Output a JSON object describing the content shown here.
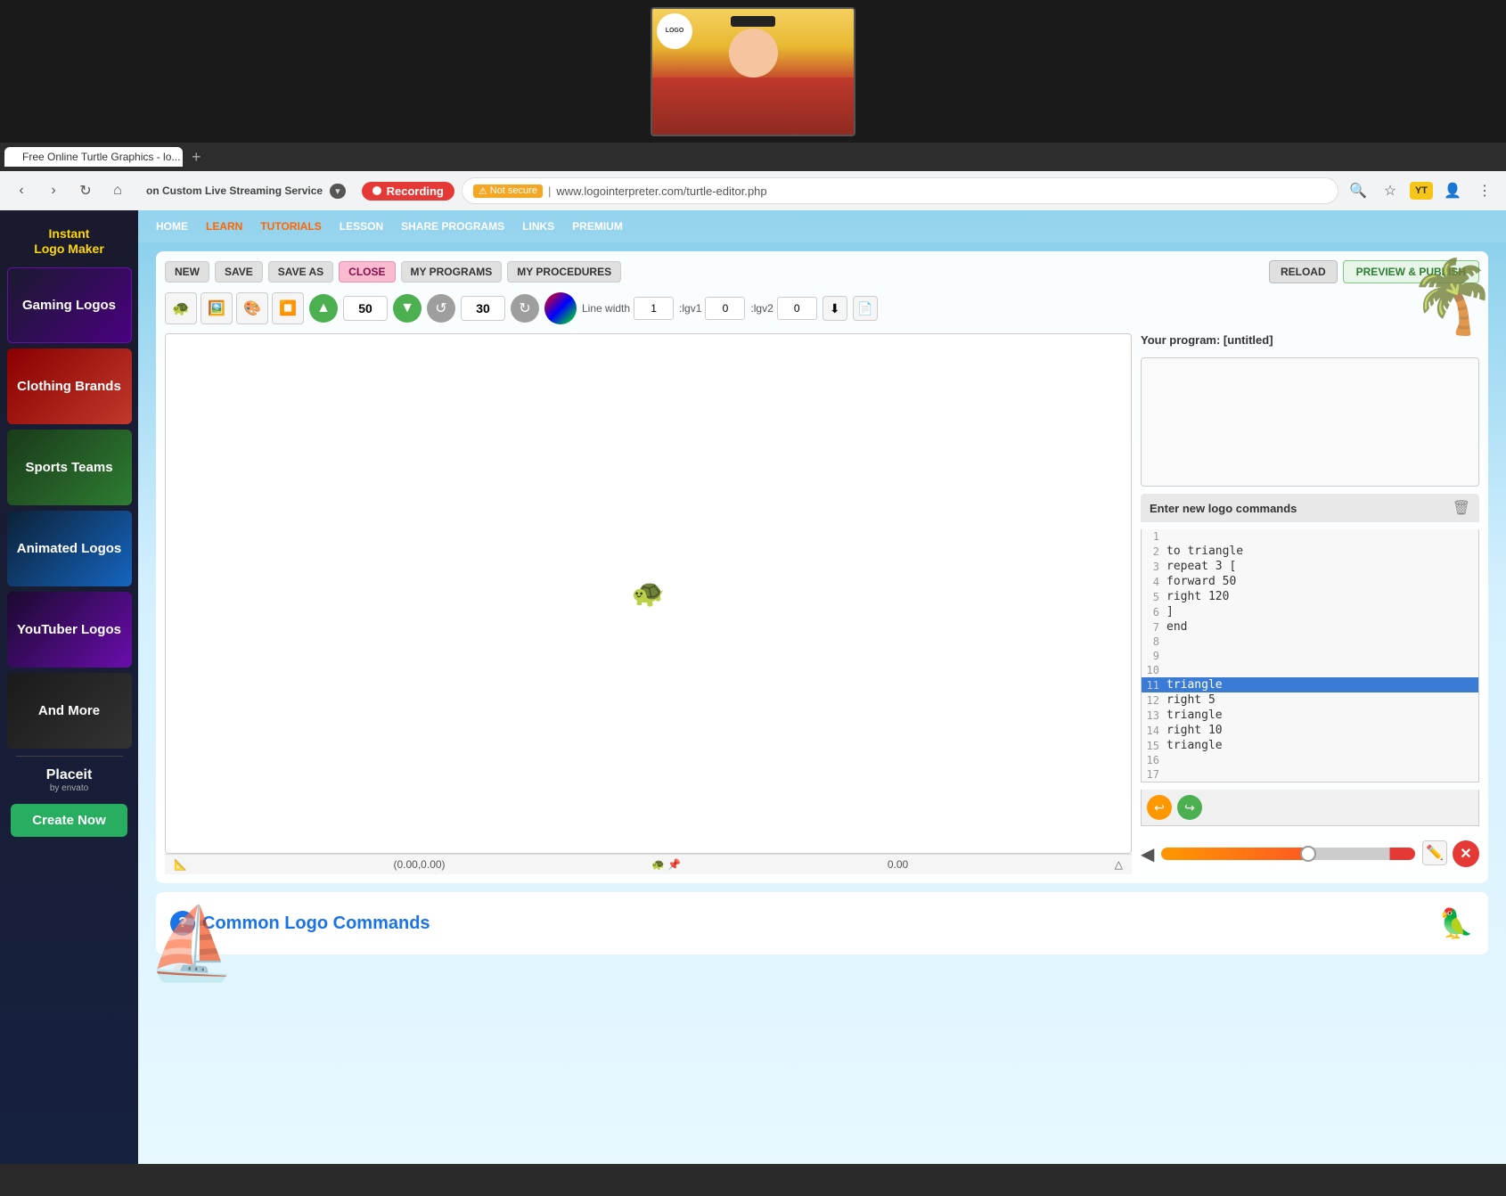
{
  "video": {
    "label": "Video thumbnail area"
  },
  "browser": {
    "tab_label": "Free Online Turtle Graphics - lo...",
    "streaming_label": "on Custom Live Streaming Service",
    "recording_label": "Recording",
    "warning_label": "Not secure",
    "address": "www.logointerpreter.com/turtle-editor.php"
  },
  "sidebar": {
    "logo_line1": "Instant",
    "logo_line2": "Logo Maker",
    "items": [
      {
        "id": "gaming",
        "label": "Gaming Logos"
      },
      {
        "id": "clothing",
        "label": "Clothing Brands"
      },
      {
        "id": "sports",
        "label": "Sports Teams"
      },
      {
        "id": "animated",
        "label": "Animated Logos"
      },
      {
        "id": "youtuber",
        "label": "YouTuber Logos"
      },
      {
        "id": "more",
        "label": "And More"
      }
    ],
    "placeit_label": "Placeit",
    "placeit_by": "by envato",
    "create_now_label": "Create Now"
  },
  "nav": {
    "items": [
      "HOME",
      "LEARN",
      "TUTORIALS",
      "LESSON",
      "SHARE PROGRAMS",
      "LINKS",
      "PREMIUM"
    ]
  },
  "editor": {
    "new_label": "NEW",
    "save_label": "SAVE",
    "save_as_label": "SAVE AS",
    "close_label": "CLOSE",
    "my_programs_label": "MY PROGRAMS",
    "my_procedures_label": "MY PROCEDURES",
    "reload_label": "RELOAD",
    "preview_publish_label": "PREVIEW & PUBLISH",
    "forward_value": "50",
    "rotate_value": "30",
    "line_width_label": "Line width",
    "line_width_value": "1",
    "lgv1_label": ":lgv1",
    "lgv1_value": "0",
    "lgv2_label": ":lgv2",
    "lgv2_value": "0",
    "program_label": "Your program: [untitled]",
    "program_content": "",
    "commands_label": "Enter new logo commands",
    "canvas_coords": "(0.00,0.00)",
    "canvas_angle": "0.00"
  },
  "code": {
    "lines": [
      {
        "num": 1,
        "text": ""
      },
      {
        "num": 2,
        "text": "to triangle"
      },
      {
        "num": 3,
        "text": "   repeat 3 ["
      },
      {
        "num": 4,
        "text": "      forward 50"
      },
      {
        "num": 5,
        "text": "      right 120"
      },
      {
        "num": 6,
        "text": "   ]"
      },
      {
        "num": 7,
        "text": "end"
      },
      {
        "num": 8,
        "text": ""
      },
      {
        "num": 9,
        "text": ""
      },
      {
        "num": 10,
        "text": ""
      },
      {
        "num": 11,
        "text": "triangle",
        "highlighted": true
      },
      {
        "num": 12,
        "text": "right 5"
      },
      {
        "num": 13,
        "text": "triangle"
      },
      {
        "num": 14,
        "text": "right 10"
      },
      {
        "num": 15,
        "text": "triangle"
      },
      {
        "num": 16,
        "text": ""
      },
      {
        "num": 17,
        "text": ""
      }
    ]
  },
  "commands_section": {
    "title": "Common Logo Commands",
    "question_mark": "?"
  }
}
